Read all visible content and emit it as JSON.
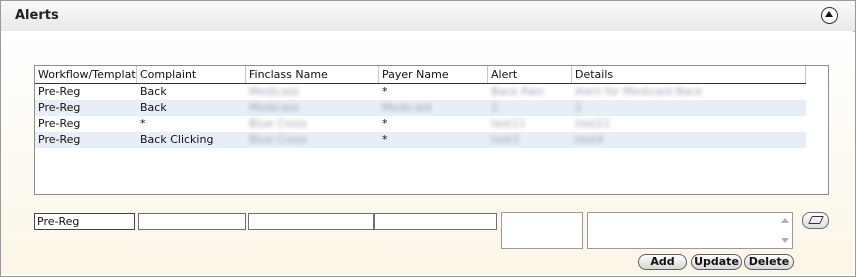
{
  "panel": {
    "title": "Alerts"
  },
  "grid": {
    "columns": [
      "Workflow/Template",
      "Complaint",
      "Finclass Name",
      "Payer Name",
      "Alert",
      "Details"
    ],
    "rows": [
      [
        "Pre-Reg",
        "Back",
        "Medicaid",
        "*",
        "Back Pain",
        "Alert for Medicaid Back"
      ],
      [
        "Pre-Reg",
        "Back",
        "Medicaid",
        "Medicaid",
        "2",
        "2"
      ],
      [
        "Pre-Reg",
        "*",
        "Blue Cross",
        "*",
        "test11",
        "test22"
      ],
      [
        "Pre-Reg",
        "Back Clicking",
        "Blue Cross",
        "*",
        "test3",
        "test4"
      ]
    ]
  },
  "form": {
    "workflow_value": "Pre-Reg",
    "complaint_value": "",
    "finclass_value": "",
    "payer_value": "",
    "alert_value": "",
    "details_value": ""
  },
  "buttons": {
    "add": "Add",
    "update": "Update",
    "delete": "Delete"
  },
  "icons": {
    "collapse": "chevron-up-icon",
    "clear": "eraser-icon"
  }
}
